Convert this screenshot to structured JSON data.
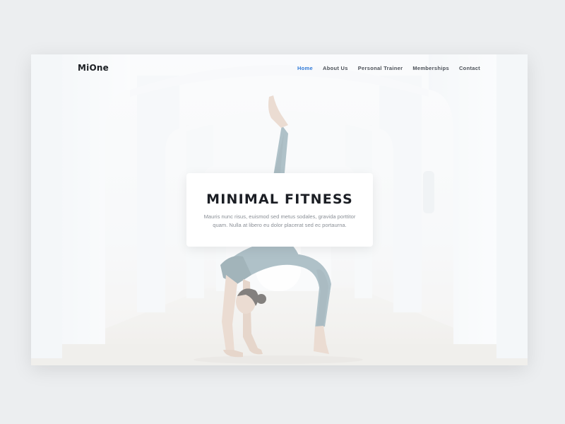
{
  "brand": {
    "logo": "MiOne"
  },
  "nav": {
    "items": [
      {
        "label": "Home",
        "active": true
      },
      {
        "label": "About Us",
        "active": false
      },
      {
        "label": "Personal Trainer",
        "active": false
      },
      {
        "label": "Memberships",
        "active": false
      },
      {
        "label": "Contact",
        "active": false
      }
    ]
  },
  "hero": {
    "title": "MINIMAL FITNESS",
    "text": "Mauris nunc risus, euismod sed metus sodales, gravida porttitor quam. Nulla at libero eu dolor placerat sed ec portaurna."
  },
  "colors": {
    "accent": "#2f7ad9",
    "background": "#eceef0",
    "heading": "#1b1e24",
    "body_text": "#8b9097",
    "outfit": "#6f8c98"
  }
}
